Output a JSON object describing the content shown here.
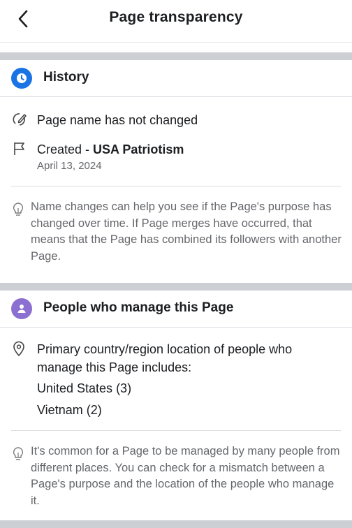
{
  "header": {
    "title": "Page transparency",
    "back_icon": "chevron-left-icon"
  },
  "history": {
    "title": "History",
    "icon": "clock-icon",
    "icon_color": "#1b74e4",
    "name_status": "Page name has not changed",
    "created_prefix": "Created - ",
    "created_name": "USA Patriotism",
    "created_date": "April 13, 2024",
    "tip": "Name changes can help you see if the Page's purpose has changed over time. If Page merges have occurred, that means that the Page has combined its followers with another Page."
  },
  "managers": {
    "title": "People who manage this Page",
    "icon": "person-icon",
    "icon_color": "#8b6fd1",
    "location_intro": "Primary country/region location of people who manage this Page includes:",
    "countries": [
      "United States (3)",
      "Vietnam (2)"
    ],
    "tip": "It's common for a Page to be managed by many people from different places. You can check for a mismatch between a Page's purpose and the location of the people who manage it."
  }
}
